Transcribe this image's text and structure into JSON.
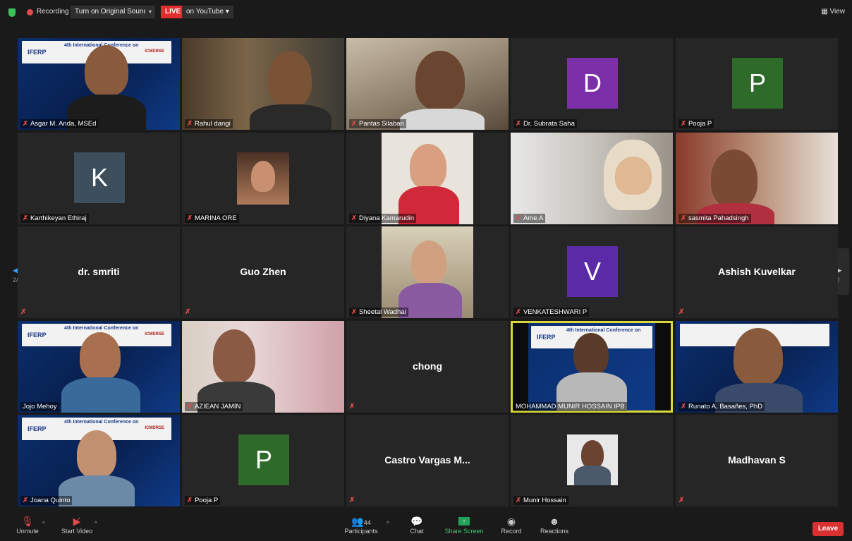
{
  "topbar": {
    "recording": "Recording",
    "sound_button": "Turn on Original Sound",
    "caret": "▾",
    "live": "LIVE",
    "youtube": "on YouTube ▾",
    "view": "View"
  },
  "nav": {
    "page_left": "2/2",
    "page_right": "2/2"
  },
  "tiles": [
    {
      "name": "Asgar M. Anda, MSEd"
    },
    {
      "name": "Rahul dangi"
    },
    {
      "name": "Pantas Silaban"
    },
    {
      "name": "Dr. Subrata Saha",
      "initial": "D",
      "color": "#7b2fa8"
    },
    {
      "name": "Pooja P",
      "initial": "P",
      "color": "#2e6b2a"
    },
    {
      "name": "Karthikeyan Ethiraj",
      "initial": "K",
      "color": "#3d4f5c"
    },
    {
      "name": "MARINA ORE"
    },
    {
      "name": "Diyana Kamarudin"
    },
    {
      "name": "Ame.A"
    },
    {
      "name": "sasmita Pahadsingh"
    },
    {
      "name": "dr. smriti"
    },
    {
      "name": "Guo Zhen"
    },
    {
      "name": "Sheetal Wadhai"
    },
    {
      "name": "VENKATESHWARI P",
      "initial": "V",
      "color": "#5b2aa6"
    },
    {
      "name": "Ashish Kuvelkar"
    },
    {
      "name": "Jojo Mehoy"
    },
    {
      "name": "AZIEAN JAMIN"
    },
    {
      "name": "chong"
    },
    {
      "name": "MOHAMMAD MUNIR HOSSAIN IPB"
    },
    {
      "name": "Runato A. Basañes, PhD"
    },
    {
      "name": "Joana Quinto"
    },
    {
      "name": "Pooja P",
      "initial": "P",
      "color": "#2e6b2a"
    },
    {
      "name": "Castro Vargas M..."
    },
    {
      "name": "Munir Hossain"
    },
    {
      "name": "Madhavan S"
    }
  ],
  "banner": {
    "title": "4th International Conference on",
    "logo": "IFERP",
    "logo2": "ICMDRSE"
  },
  "toolbar": {
    "unmute": "Unmute",
    "start_video": "Start Video",
    "participants": "Participants",
    "participants_count": "44",
    "chat": "Chat",
    "share": "Share Screen",
    "record": "Record",
    "reactions": "Reactions",
    "leave": "Leave"
  },
  "colors": {
    "accent_green": "#23a35a",
    "leave_red": "#d93030",
    "active_border": "#d8d83a",
    "mic_red": "#e34b4b"
  }
}
